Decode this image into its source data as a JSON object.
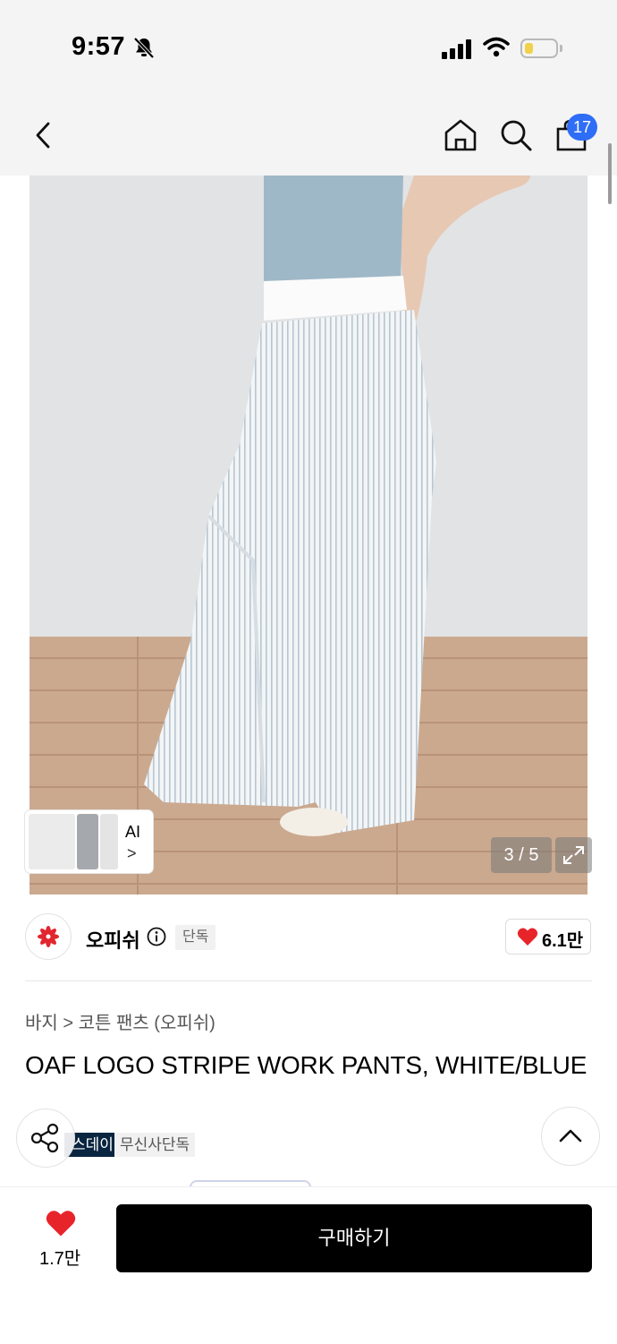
{
  "status_bar": {
    "time": "9:57"
  },
  "header": {
    "cart_count": "17"
  },
  "gallery": {
    "counter": "3 / 5",
    "ai_label": "AI",
    "ai_chevron": ">"
  },
  "brand": {
    "name": "오피쉬",
    "exclusive_tag": "단독",
    "likes": "6.1만"
  },
  "product": {
    "breadcrumb": "바지 > 코튼 팬츠 (오피쉬)",
    "title": "OAF LOGO STRIPE WORK PANTS, WHITE/BLUE",
    "tags": [
      "스데이",
      "무신사단독"
    ]
  },
  "footer": {
    "wish_count": "1.7만",
    "buy_label": "구매하기"
  },
  "colors": {
    "accent_blue": "#2e6df6",
    "heart_red": "#e8242b",
    "brand_red": "#e2262f",
    "tag_navy": "#0a2540"
  }
}
